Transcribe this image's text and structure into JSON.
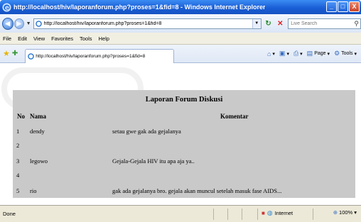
{
  "window": {
    "title": "http://localhost/hiv/laporanforum.php?proses=1&fid=8 - Windows Internet Explorer",
    "minimize": "_",
    "maximize": "□",
    "close": "X"
  },
  "address_bar": {
    "url": "http://localhost/hiv/laporanforum.php?proses=1&fid=8",
    "search_placeholder": "Live Search"
  },
  "menu": [
    "File",
    "Edit",
    "View",
    "Favorites",
    "Tools",
    "Help"
  ],
  "tab": {
    "label": "http://localhost/hiv/laporanforum.php?proses=1&fid=8"
  },
  "command_bar": {
    "page_label": "Page",
    "tools_label": "Tools"
  },
  "report": {
    "title": "Laporan Forum Diskusi",
    "headers": {
      "no": "No",
      "nama": "Nama",
      "komentar": "Komentar"
    },
    "rows": [
      {
        "no": "1",
        "nama": "dendy",
        "komentar": "setau gwe gak ada gejalanya"
      },
      {
        "no": "2",
        "nama": "",
        "komentar": ""
      },
      {
        "no": "3",
        "nama": "legowo",
        "komentar": "Gejala-Gejala HIV itu apa aja ya.."
      },
      {
        "no": "4",
        "nama": "",
        "komentar": ""
      },
      {
        "no": "5",
        "nama": "rio",
        "komentar": "gak ada gejalanya bro. gejala akan muncul setelah masuk fase AIDS..."
      }
    ]
  },
  "status": {
    "text": "Done",
    "zone": "Internet",
    "zoom": "100%"
  },
  "icons": [
    "ie-icon",
    "back-arrow-icon",
    "forward-arrow-icon",
    "refresh-icon",
    "stop-icon",
    "search-icon",
    "favorites-star-icon",
    "add-favorites-icon",
    "home-icon",
    "feeds-icon",
    "print-icon",
    "page-icon",
    "tools-icon",
    "globe-icon",
    "lock-icon"
  ]
}
